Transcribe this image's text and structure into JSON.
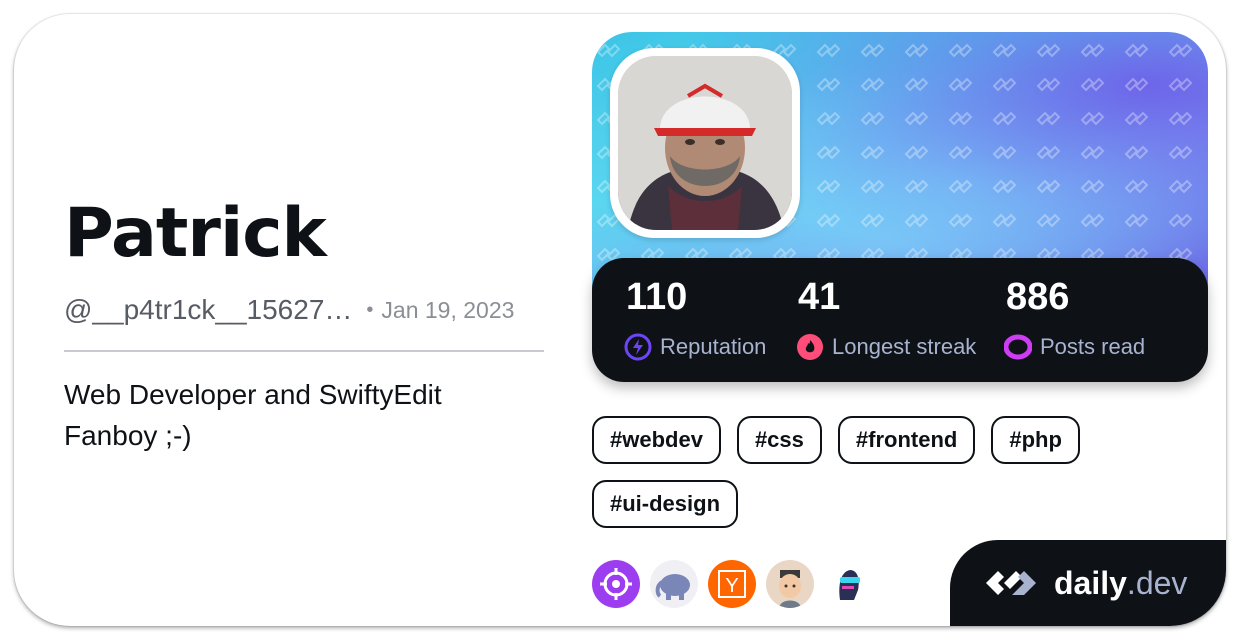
{
  "profile": {
    "name": "Patrick",
    "handle": "@__p4tr1ck__15627…",
    "separator": "•",
    "joined": "Jan 19, 2023",
    "bio": "Web Developer and SwiftyEdit Fanboy ;-)"
  },
  "stats": [
    {
      "value": "110",
      "label": "Reputation",
      "icon": "bolt-icon",
      "color": "#6c45f6"
    },
    {
      "value": "41",
      "label": "Longest streak",
      "icon": "flame-icon",
      "color": "#ff4d7a"
    },
    {
      "value": "886",
      "label": "Posts read",
      "icon": "ring-icon",
      "color": "#ce3df3"
    }
  ],
  "tags": [
    "#webdev",
    "#css",
    "#frontend",
    "#php",
    "#ui-design"
  ],
  "sources": [
    {
      "icon": "crosshair-icon",
      "color": "#9d3df0"
    },
    {
      "icon": "php-elephant-icon",
      "color": "#7a86b8"
    },
    {
      "icon": "ycombinator-icon",
      "color": "#ff6600",
      "letter": "Y"
    },
    {
      "icon": "avatar-face-icon",
      "color": "#e9d6c4"
    },
    {
      "icon": "robot-head-icon",
      "color": "#2a2f55"
    }
  ],
  "brand": {
    "name": "daily",
    "dot": ".",
    "tld": "dev"
  },
  "colors": {
    "dark": "#0e1217",
    "muted": "#a8b3cf"
  }
}
